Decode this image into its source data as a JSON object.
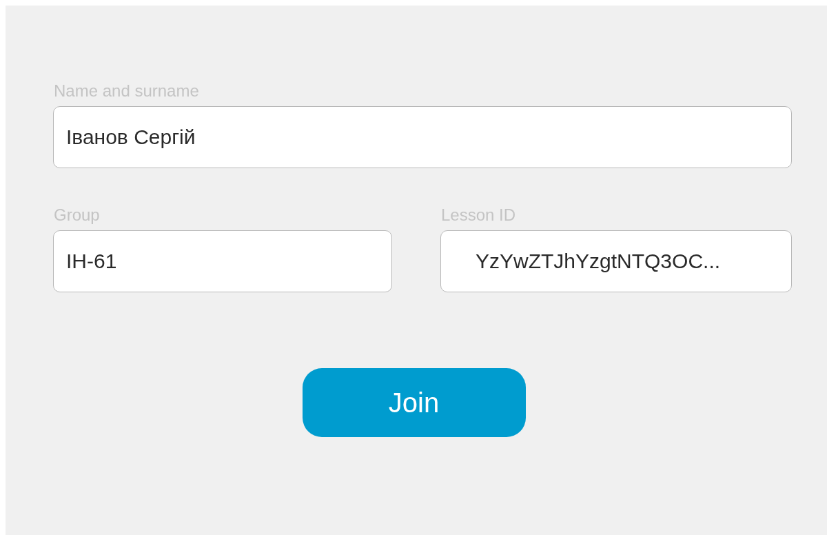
{
  "fields": [
    {
      "label": "Name and surname",
      "value": "Іванов Сергій"
    },
    {
      "label": "Group",
      "value": "ІН-61"
    },
    {
      "label": "Lesson ID",
      "value": "YzYwZTJhYzgtNTQ3OC..."
    }
  ],
  "button": {
    "label": "Join"
  }
}
